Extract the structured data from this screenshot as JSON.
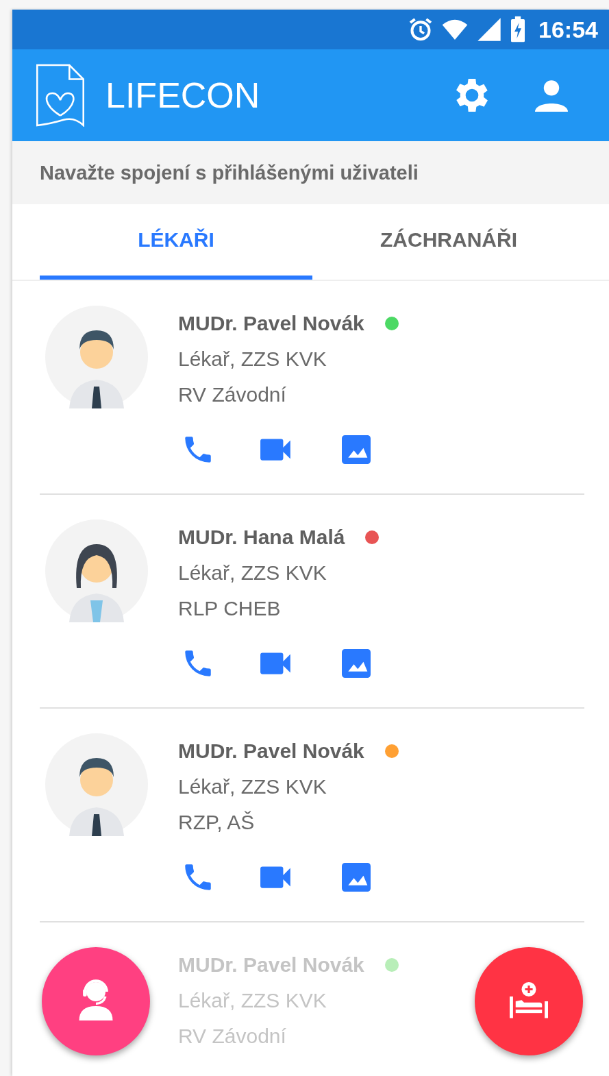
{
  "status_bar": {
    "time": "16:54"
  },
  "app_bar": {
    "title": "LIFECON"
  },
  "subtitle": "Navažte spojení s přihlášenými uživateli",
  "tabs": [
    {
      "label": "LÉKAŘI",
      "selected": true
    },
    {
      "label": "ZÁCHRANÁŘI",
      "selected": false
    }
  ],
  "contacts": [
    {
      "name": "MUDr. Pavel Novák",
      "role": "Lékař, ZZS KVK",
      "station": "RV Závodní",
      "color": "#4cd964",
      "kind": "male",
      "actions": true,
      "faded": false
    },
    {
      "name": "MUDr. Hana Malá",
      "role": "Lékař, ZZS KVK",
      "station": "RLP CHEB",
      "color": "#e85454",
      "kind": "female",
      "actions": true,
      "faded": false
    },
    {
      "name": "MUDr. Pavel Novák",
      "role": "Lékař, ZZS KVK",
      "station": "RZP, AŠ",
      "color": "#ffa033",
      "kind": "male",
      "actions": true,
      "faded": false
    },
    {
      "name": "MUDr. Pavel Novák",
      "role": "Lékař, ZZS KVK",
      "station": "RV Závodní",
      "color": "#b8eeb8",
      "kind": "covered",
      "actions": false,
      "faded": true
    }
  ],
  "fabs": [
    {
      "kind": "operator"
    },
    {
      "kind": "hospital-bed"
    }
  ]
}
